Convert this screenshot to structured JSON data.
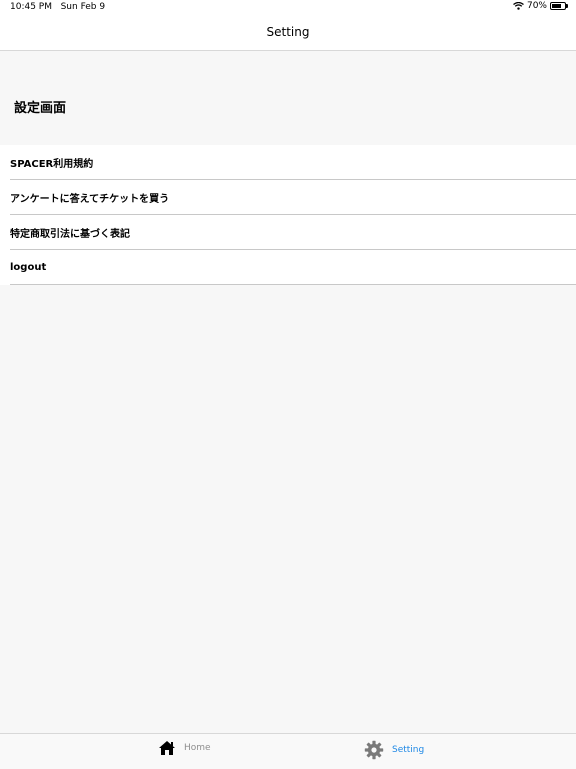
{
  "status_bar": {
    "time": "10:45 PM",
    "date": "Sun Feb 9",
    "battery": "70%",
    "battery_level": 0.7,
    "wifi_icon": "wifi-icon",
    "battery_icon": "battery-icon"
  },
  "nav": {
    "title": "Setting"
  },
  "page": {
    "heading": "設定画面"
  },
  "menu": {
    "items": [
      {
        "label": "SPACER利用規約"
      },
      {
        "label": "アンケートに答えてチケットを買う"
      },
      {
        "label": "特定商取引法に基づく表記"
      },
      {
        "label": "logout"
      }
    ]
  },
  "tabs": [
    {
      "label": "Home",
      "icon": "home-icon",
      "active": false
    },
    {
      "label": "Setting",
      "icon": "gear-icon",
      "active": true
    }
  ],
  "colors": {
    "active_tab": "#1e88e5",
    "inactive_tab": "#8e8e8e"
  }
}
